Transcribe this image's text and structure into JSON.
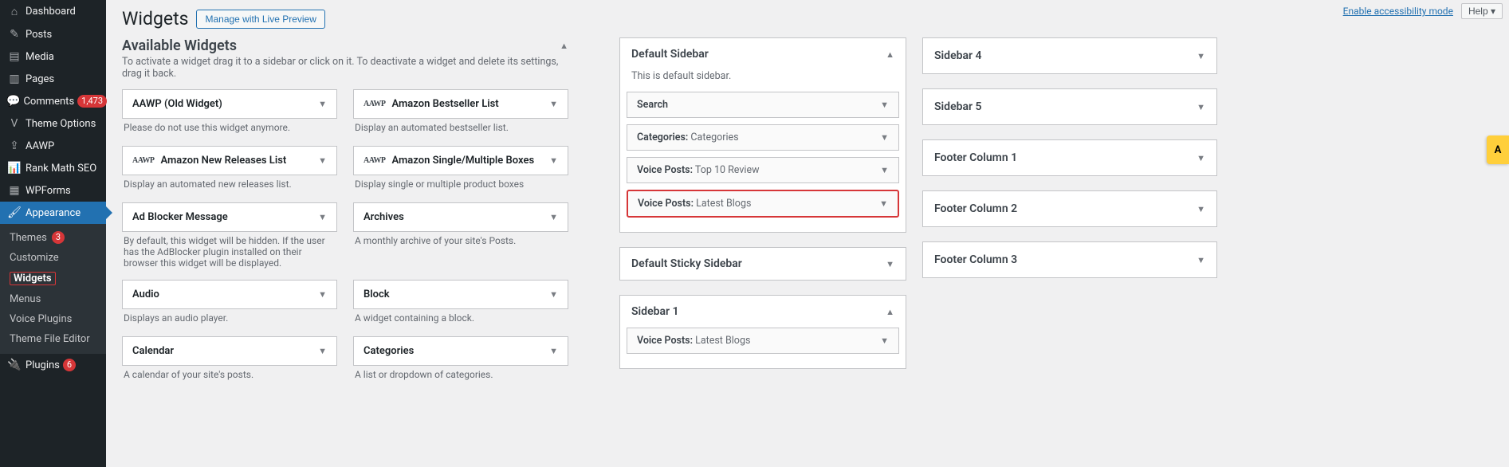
{
  "top": {
    "accessibility": "Enable accessibility mode",
    "help": "Help ▾"
  },
  "header": {
    "title": "Widgets",
    "preview_btn": "Manage with Live Preview"
  },
  "sidebar": {
    "items": [
      {
        "icon": "dashboard-icon",
        "glyph": "⌂",
        "label": "Dashboard"
      },
      {
        "icon": "posts-icon",
        "glyph": "✎",
        "label": "Posts"
      },
      {
        "icon": "media-icon",
        "glyph": "▤",
        "label": "Media"
      },
      {
        "icon": "pages-icon",
        "glyph": "▥",
        "label": "Pages"
      },
      {
        "icon": "comments-icon",
        "glyph": "💬",
        "label": "Comments",
        "badge": "1,473"
      },
      {
        "icon": "theme-options-icon",
        "glyph": "V",
        "label": "Theme Options"
      },
      {
        "icon": "aawp-icon",
        "glyph": "⇪",
        "label": "AAWP"
      },
      {
        "icon": "rankmath-icon",
        "glyph": "📊",
        "label": "Rank Math SEO"
      },
      {
        "icon": "wpforms-icon",
        "glyph": "▦",
        "label": "WPForms"
      },
      {
        "icon": "appearance-icon",
        "glyph": "🖌",
        "label": "Appearance",
        "active": true,
        "sub": [
          {
            "label": "Themes",
            "badge": "3"
          },
          {
            "label": "Customize"
          },
          {
            "label": "Widgets",
            "selected": true
          },
          {
            "label": "Menus"
          },
          {
            "label": "Voice Plugins"
          },
          {
            "label": "Theme File Editor"
          }
        ]
      },
      {
        "icon": "plugins-icon",
        "glyph": "🔌",
        "label": "Plugins",
        "badge": "6"
      }
    ]
  },
  "available": {
    "title": "Available Widgets",
    "desc": "To activate a widget drag it to a sidebar or click on it. To deactivate a widget and delete its settings, drag it back.",
    "rows": [
      {
        "left": {
          "label": "AAWP (Old Widget)",
          "desc": "Please do not use this widget anymore."
        },
        "right": {
          "label": "Amazon Bestseller List",
          "desc": "Display an automated bestseller list.",
          "aawp": true
        }
      },
      {
        "left": {
          "label": "Amazon New Releases List",
          "desc": "Display an automated new releases list.",
          "aawp": true
        },
        "right": {
          "label": "Amazon Single/Multiple Boxes",
          "desc": "Display single or multiple product boxes",
          "aawp": true
        }
      },
      {
        "left": {
          "label": "Ad Blocker Message",
          "desc": "By default, this widget will be hidden. If the user has the AdBlocker plugin installed on their browser this widget will be displayed."
        },
        "right": {
          "label": "Archives",
          "desc": "A monthly archive of your site's Posts."
        }
      },
      {
        "left": {
          "label": "Audio",
          "desc": "Displays an audio player."
        },
        "right": {
          "label": "Block",
          "desc": "A widget containing a block."
        }
      },
      {
        "left": {
          "label": "Calendar",
          "desc": "A calendar of your site's posts."
        },
        "right": {
          "label": "Categories",
          "desc": "A list or dropdown of categories."
        }
      }
    ]
  },
  "areas": {
    "default_sidebar": {
      "title": "Default Sidebar",
      "desc": "This is default sidebar.",
      "items": [
        {
          "name": "Search",
          "sub": ""
        },
        {
          "name": "Categories",
          "sub": "Categories"
        },
        {
          "name": "Voice Posts",
          "sub": "Top 10 Review"
        },
        {
          "name": "Voice Posts",
          "sub": "Latest Blogs",
          "highlight": true
        }
      ]
    },
    "default_sticky": {
      "title": "Default Sticky Sidebar"
    },
    "sidebar1": {
      "title": "Sidebar 1",
      "items": [
        {
          "name": "Voice Posts",
          "sub": "Latest Blogs"
        }
      ]
    },
    "right_panels": [
      {
        "title": "Sidebar 4"
      },
      {
        "title": "Sidebar 5"
      },
      {
        "title": "Footer Column 1"
      },
      {
        "title": "Footer Column 2"
      },
      {
        "title": "Footer Column 3"
      }
    ]
  },
  "yellow_tab": "A"
}
